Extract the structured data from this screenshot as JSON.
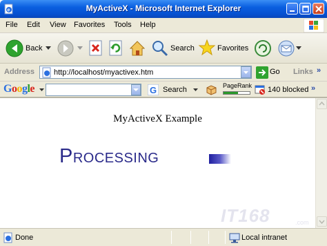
{
  "window": {
    "title": "MyActiveX - Microsoft Internet Explorer"
  },
  "menu": {
    "items": [
      "File",
      "Edit",
      "View",
      "Favorites",
      "Tools",
      "Help"
    ]
  },
  "toolbar": {
    "back_label": "Back",
    "search_label": "Search",
    "favorites_label": "Favorites"
  },
  "address": {
    "label": "Address",
    "url": "http://localhost/myactivex.htm",
    "go_label": "Go",
    "links_label": "Links"
  },
  "googlebar": {
    "logo": "Google",
    "search_value": "",
    "search_label": "Search",
    "pagerank_label": "PageRank",
    "blocked_label": "140 blocked"
  },
  "page": {
    "heading": "MyActiveX Example",
    "processing_first": "P",
    "processing_rest": "ROCESSING",
    "watermark": "IT168",
    "watermark_sub": ".com"
  },
  "status": {
    "text": "Done",
    "zone": "Local intranet"
  },
  "colors": {
    "titlebar": "#0a5fe0",
    "processing_text": "#2a2a8a",
    "chrome": "#ece9d8"
  }
}
